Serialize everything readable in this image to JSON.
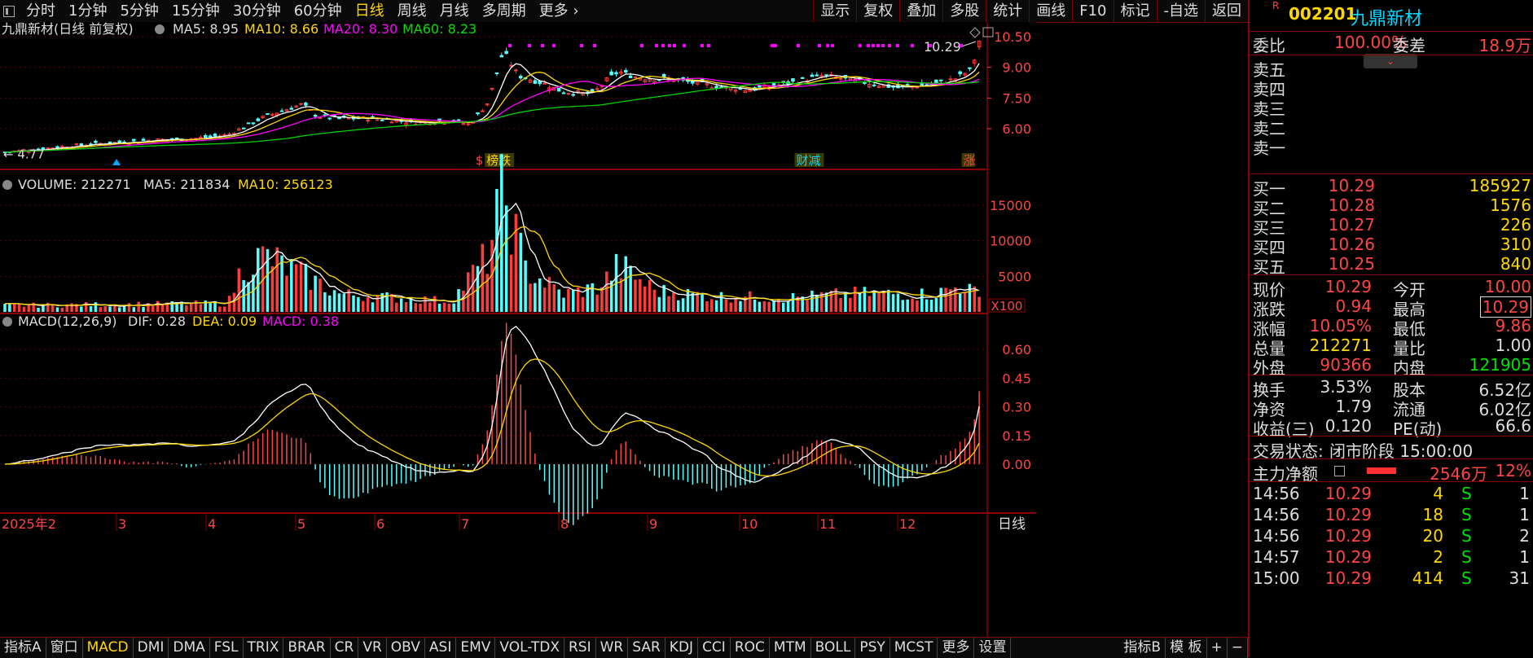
{
  "toolbar": {
    "periods": [
      "分时",
      "1分钟",
      "5分钟",
      "15分钟",
      "30分钟",
      "60分钟",
      "日线",
      "周线",
      "月线",
      "多周期",
      "更多 ›"
    ],
    "active_period": "日线",
    "actions": [
      "显示",
      "复权",
      "叠加",
      "多股",
      "统计",
      "画线",
      "F10",
      "标记",
      "-自选",
      "返回"
    ]
  },
  "stock": {
    "flag": "R",
    "code": "002201",
    "name": "九鼎新材"
  },
  "chart_header": {
    "title": "九鼎新材(日线 前复权)",
    "ma5": "MA5: 8.95",
    "ma10": "MA10: 8.66",
    "ma20": "MA20: 8.30",
    "ma60": "MA60: 8.23"
  },
  "volume_header": {
    "label": "VOLUME: 212271",
    "ma5": "MA5: 211834",
    "ma10": "MA10: 256123"
  },
  "macd_header": {
    "label": "MACD(12,26,9)",
    "dif": "DIF: 0.28",
    "dea": "DEA: 0.09",
    "macd": "MACD: 0.38"
  },
  "chart_data": {
    "type": "candlestick",
    "price_axis": [
      "10.50",
      "9.00",
      "7.50",
      "6.00"
    ],
    "price_low_label": "4.77",
    "price_high_label": "10.29",
    "volume_axis": [
      "15000",
      "10000",
      "5000"
    ],
    "volume_unit": "X100",
    "macd_axis": [
      "0.60",
      "0.45",
      "0.30",
      "0.15",
      "0.00"
    ],
    "months": [
      "2025年2",
      "3",
      "4",
      "5",
      "6",
      "7",
      "8",
      "9",
      "10",
      "11",
      "12"
    ],
    "period_label": "日线",
    "event_tags": [
      "$",
      "榜跌",
      "财减",
      "涨"
    ],
    "colors": {
      "up": "#ff3b3b",
      "down": "#54ffff",
      "ma5": "#ffffff",
      "ma10": "#ffd700",
      "ma20": "#ff00ff",
      "ma60": "#00d000"
    }
  },
  "orderbook": {
    "wb_label": "委比",
    "wb_value": "100.00%",
    "wc_label": "委差",
    "wc_value": "18.9万",
    "sells": [
      {
        "label": "卖五",
        "price": "",
        "vol": ""
      },
      {
        "label": "卖四",
        "price": "",
        "vol": ""
      },
      {
        "label": "卖三",
        "price": "",
        "vol": ""
      },
      {
        "label": "卖二",
        "price": "",
        "vol": ""
      },
      {
        "label": "卖一",
        "price": "",
        "vol": ""
      }
    ],
    "buys": [
      {
        "label": "买一",
        "price": "10.29",
        "vol": "185927"
      },
      {
        "label": "买二",
        "price": "10.28",
        "vol": "1576"
      },
      {
        "label": "买三",
        "price": "10.27",
        "vol": "226"
      },
      {
        "label": "买四",
        "price": "10.26",
        "vol": "310"
      },
      {
        "label": "买五",
        "price": "10.25",
        "vol": "840"
      }
    ]
  },
  "quote": [
    {
      "l1": "现价",
      "v1": "10.29",
      "c1": "r",
      "l2": "今开",
      "v2": "10.00",
      "c2": "r"
    },
    {
      "l1": "涨跌",
      "v1": "0.94",
      "c1": "r",
      "l2": "最高",
      "v2": "10.29",
      "c2": "r"
    },
    {
      "l1": "涨幅",
      "v1": "10.05%",
      "c1": "r",
      "l2": "最低",
      "v2": "9.86",
      "c2": "r"
    },
    {
      "l1": "总量",
      "v1": "212271",
      "c1": "y",
      "l2": "量比",
      "v2": "1.00",
      "c2": "w"
    },
    {
      "l1": "外盘",
      "v1": "90366",
      "c1": "r",
      "l2": "内盘",
      "v2": "121905",
      "c2": "g"
    },
    {
      "l1": "换手",
      "v1": "3.53%",
      "c1": "w",
      "l2": "股本",
      "v2": "6.52亿",
      "c2": "w"
    },
    {
      "l1": "净资",
      "v1": "1.79",
      "c1": "w",
      "l2": "流通",
      "v2": "6.02亿",
      "c2": "w"
    },
    {
      "l1": "收益(三)",
      "v1": "0.120",
      "c1": "w",
      "l2": "PE(动)",
      "v2": "66.6",
      "c2": "w"
    }
  ],
  "status": {
    "label": "交易状态:",
    "value": "闭市阶段 15:00:00"
  },
  "fund": {
    "label": "主力净额",
    "value": "2546万",
    "pct": "12%"
  },
  "trades": [
    {
      "time": "14:56",
      "price": "10.29",
      "vol": "4",
      "side": "S",
      "n": "1"
    },
    {
      "time": "14:56",
      "price": "10.29",
      "vol": "18",
      "side": "S",
      "n": "1"
    },
    {
      "time": "14:56",
      "price": "10.29",
      "vol": "20",
      "side": "S",
      "n": "2"
    },
    {
      "time": "14:57",
      "price": "10.29",
      "vol": "2",
      "side": "S",
      "n": "1"
    },
    {
      "time": "15:00",
      "price": "10.29",
      "vol": "414",
      "side": "S",
      "n": "31"
    }
  ],
  "bottom_tabs": [
    "指标A",
    "窗口",
    "MACD",
    "DMI",
    "DMA",
    "FSL",
    "TRIX",
    "BRAR",
    "CR",
    "VR",
    "OBV",
    "ASI",
    "EMV",
    "VOL-TDX",
    "RSI",
    "WR",
    "SAR",
    "KDJ",
    "CCI",
    "ROC",
    "MTM",
    "BOLL",
    "PSY",
    "MCST",
    "更多",
    "设置"
  ],
  "bottom_active": "MACD",
  "bottom_right": [
    "指标B",
    "模 板",
    "+",
    "−"
  ]
}
